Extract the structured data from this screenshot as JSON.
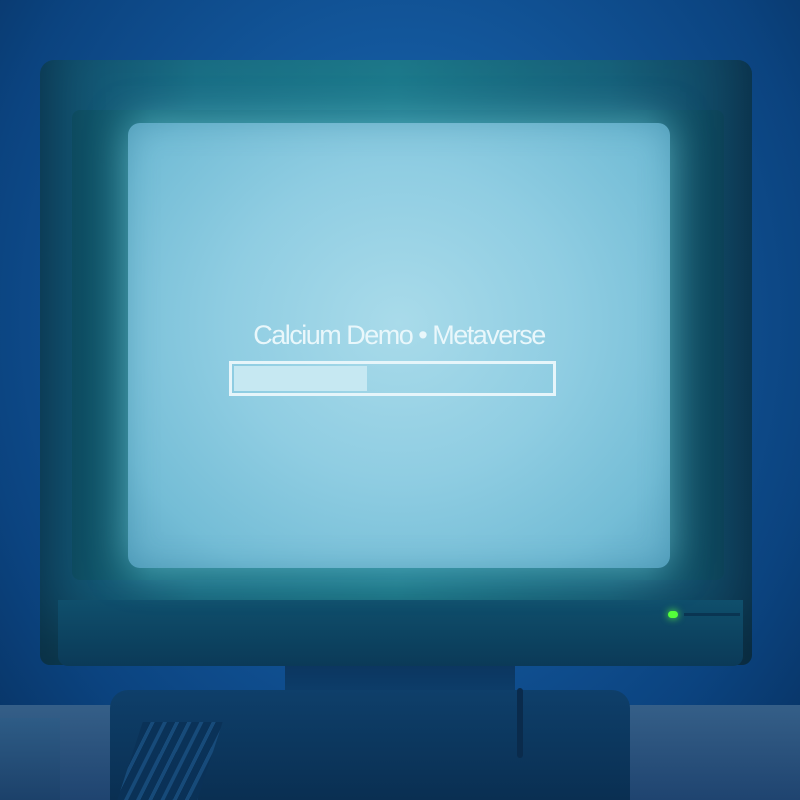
{
  "screen": {
    "title": "Calcium Demo • Metaverse",
    "progress_percent": 42
  },
  "colors": {
    "background": "#145aa0",
    "screen_glow": "#a9dbea",
    "screen_text": "#e9f7fb",
    "progress_border": "#e6f5fa",
    "progress_fill": "#c6e8f2",
    "power_led": "#54ff3a"
  },
  "icons": {
    "power_led": "power-indicator-icon"
  }
}
